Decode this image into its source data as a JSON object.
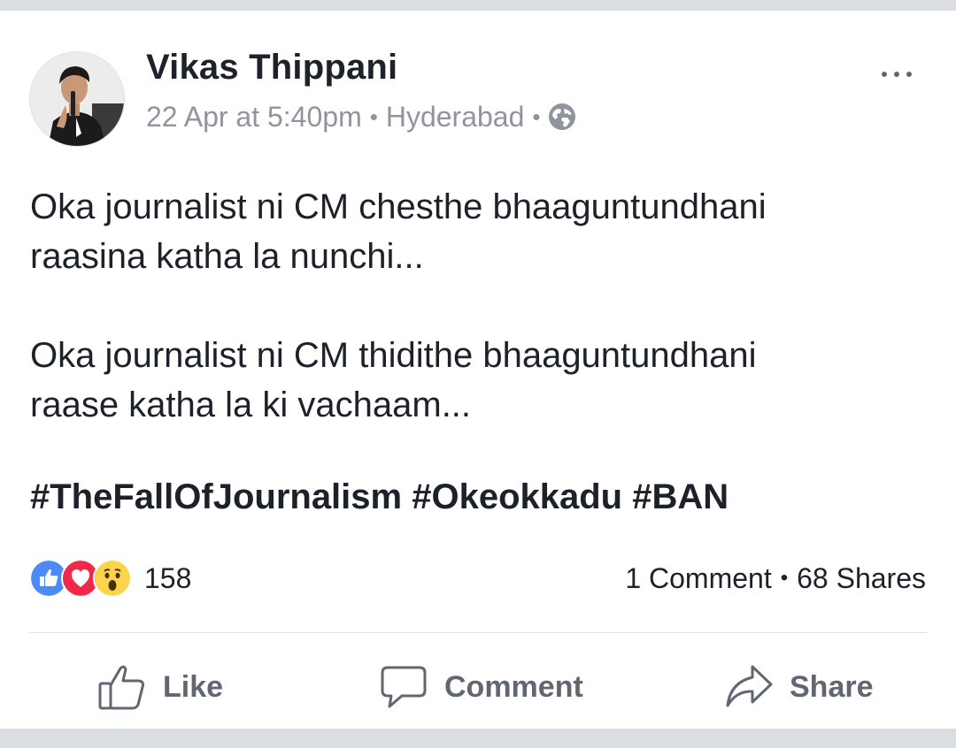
{
  "post": {
    "author": "Vikas Thippani",
    "date": "22 Apr at 5:40pm",
    "location": "Hyderabad",
    "separator": "•",
    "privacy_icon": "globe-icon",
    "paragraphs": [
      [
        "Oka journalist ni CM chesthe bhaaguntundhani",
        "raasina katha la nunchi..."
      ],
      [
        "Oka journalist ni CM thidithe bhaaguntundhani",
        "raase katha la ki vachaam..."
      ]
    ],
    "hashtags": "#TheFallOfJournalism #Okeokkadu #BAN"
  },
  "reactions": {
    "icons": [
      "like-reaction-icon",
      "love-reaction-icon",
      "wow-reaction-icon"
    ],
    "count": "158"
  },
  "stats": {
    "comments": "1 Comment",
    "separator": "•",
    "shares": "68 Shares"
  },
  "actions": {
    "like": "Like",
    "comment": "Comment",
    "share": "Share"
  },
  "colors": {
    "like_blue": "#4c8bf5",
    "love_red": "#f0284a",
    "wow_yellow": "#fcd34d",
    "text": "#1d2129",
    "secondary": "#90949c",
    "action": "#606770"
  }
}
